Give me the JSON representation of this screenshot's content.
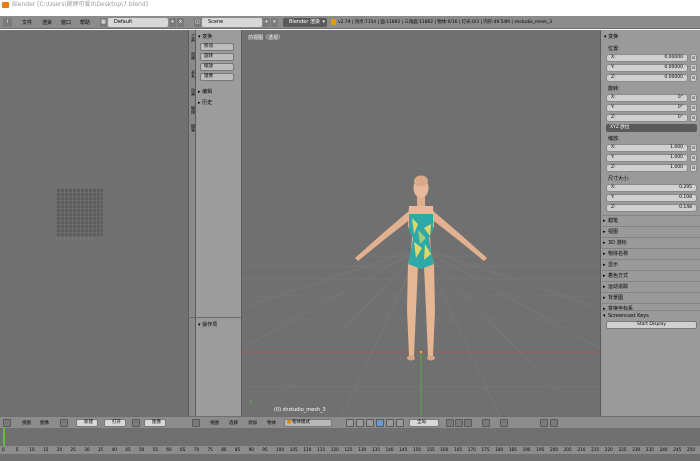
{
  "window": {
    "title": "Blender [C:\\Users\\婉婷可爱0\\Desktop\\7.blend]"
  },
  "topbar": {
    "menus": [
      "文件",
      "渲染",
      "窗口",
      "帮助"
    ],
    "layout": "Default",
    "scene": "Scene",
    "engine": "Blender 渲染",
    "stats": "v2.79 | 顶点:7154 | 面:11862 | 三角面:11862 | 物体:0/16 | 灯光:0/3 | 内存:49.54M | shstudio_mesh_3"
  },
  "toolshelf": {
    "tabs": [
      "工具",
      "创建",
      "关系",
      "动画",
      "物理",
      "蜡笔"
    ],
    "transform_header": "变换",
    "buttons": [
      "移动",
      "旋转",
      "缩放",
      "镜像"
    ],
    "edit_header": "编辑",
    "history_header": "历史",
    "operator_header": "操作项"
  },
  "viewport": {
    "label": "前视图（透视）",
    "object": "(0) shstudio_mesh_3"
  },
  "properties": {
    "transform_header": "变换",
    "location_label": "位置:",
    "location": [
      {
        "axis": "X:",
        "value": "0.00000"
      },
      {
        "axis": "Y:",
        "value": "0.00000"
      },
      {
        "axis": "Z:",
        "value": "0.00000"
      }
    ],
    "rotation_label": "旋转:",
    "rotation": [
      {
        "axis": "X:",
        "value": "0°"
      },
      {
        "axis": "Y:",
        "value": "0°"
      },
      {
        "axis": "Z:",
        "value": "0°"
      }
    ],
    "rotation_mode": "XYZ 欧拉",
    "scale_label": "缩放:",
    "scale": [
      {
        "axis": "X:",
        "value": "1.000"
      },
      {
        "axis": "Y:",
        "value": "1.000"
      },
      {
        "axis": "Z:",
        "value": "1.000"
      }
    ],
    "dimensions_label": "尺寸大小:",
    "dimensions": [
      {
        "axis": "X:",
        "value": "0.295"
      },
      {
        "axis": "Y:",
        "value": "0.108"
      },
      {
        "axis": "Z:",
        "value": "0.148"
      }
    ],
    "sections": [
      "蜡笔",
      "视图",
      "3D 游标",
      "物体名称",
      "显示",
      "着色方式",
      "运动追踪",
      "背景图",
      "变换坐标系",
      "Screencast Keys"
    ],
    "start_display": "Start Display"
  },
  "bottombar": {
    "left": [
      "视图",
      "图像"
    ],
    "left_new": "新建",
    "left_open": "打开",
    "left_image": "图像",
    "view_menus": [
      "视图",
      "选择",
      "添加",
      "物体"
    ],
    "mode": "物体模式",
    "global": "全局"
  },
  "timeline": {
    "ticks": [
      "0",
      "5",
      "10",
      "15",
      "20",
      "25",
      "30",
      "35",
      "40",
      "45",
      "50",
      "55",
      "60",
      "65",
      "70",
      "75",
      "80",
      "85",
      "90",
      "95",
      "100",
      "105",
      "110",
      "115",
      "120",
      "125",
      "130",
      "135",
      "140",
      "145",
      "150",
      "155",
      "160",
      "165",
      "170",
      "175",
      "180",
      "185",
      "190",
      "195",
      "200",
      "205",
      "210",
      "215",
      "220",
      "225",
      "230",
      "235",
      "240",
      "245",
      "250"
    ]
  },
  "colors": {
    "viewport_bg": "#707070",
    "header_bg": "#8c8c8c",
    "panel_bg": "#9a9a9a",
    "x_axis": "#c44242",
    "y_axis": "#55b04a",
    "swimsuit_teal": "#2fa9a8",
    "swimsuit_yellow": "#e2d66a",
    "skin": "#e6b99a"
  }
}
